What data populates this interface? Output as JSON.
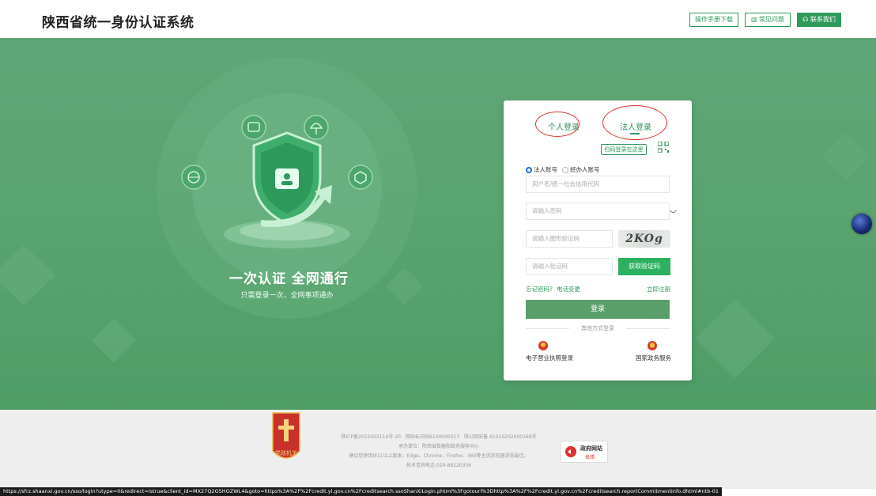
{
  "header": {
    "title": "陕西省统一身份认证系统",
    "manual_label": "操作手册下载",
    "faq_label": "常见问题",
    "contact_label": "联系我们"
  },
  "hero": {
    "slogan": "一次认证 全网通行",
    "sub_slogan": "只需登录一次，全网事项通办"
  },
  "login": {
    "tab_personal": "个人登录",
    "tab_legal": "法人登录",
    "active_tab": "法人登录",
    "scan_tip": "扫码登录在这里",
    "radio_legal_account": "法人账号",
    "radio_agent_account": "经办人账号",
    "selected_radio": "法人账号",
    "account_placeholder": "用户名/统一社会信用代码",
    "password_placeholder": "请输入密码",
    "captcha_placeholder": "请输入图形验证码",
    "captcha_text": "2KOg",
    "sms_placeholder": "请输入验证码",
    "sms_button": "获取验证码",
    "forgot_password": "忘记密码?",
    "phone_change": "电话变更",
    "register": "立即注册",
    "login_button": "登录",
    "other_methods": "其他方式登录",
    "license_login": "电子营业执照登录",
    "gov_service": "国家政务服务"
  },
  "footer": {
    "line1": "陕ICP备2022003114号-20　网站标识码6100000017　陕公网安备 61010202000169号",
    "line2": "承办单位：陕西省数据和政务服务中心",
    "line3": "建议您使用IE11以上版本、Edge、Chrome、Firefox、360等主流浏览器浏览最佳。",
    "line4": "技术咨询电话:029-88220356",
    "badge_text": "党政机关",
    "gov_site_title": "政府网站",
    "gov_site_sub": "找错"
  },
  "status_url": "https://sfrz.shaanxi.gov.cn/sso/login?utype=0&redirect=istrue&client_id=MX27Q2G5HOZWL4&goto=https%3A%2F%2Fcredit.yl.gov.cn%2Fcreditsearch.ssoShanXiLogin.phtml%3Fgotourl%3Dhttp%3A%2F%2Fcredit.yl.gov.cn%2Fcreditsearch.reportCommitmentInfo.dhtml#ntb-01",
  "colors": {
    "brand_green": "#2f9a5c",
    "hero_green": "#5aa470",
    "login_button": "#5a9f6a",
    "annotation_red": "#e0312a"
  }
}
